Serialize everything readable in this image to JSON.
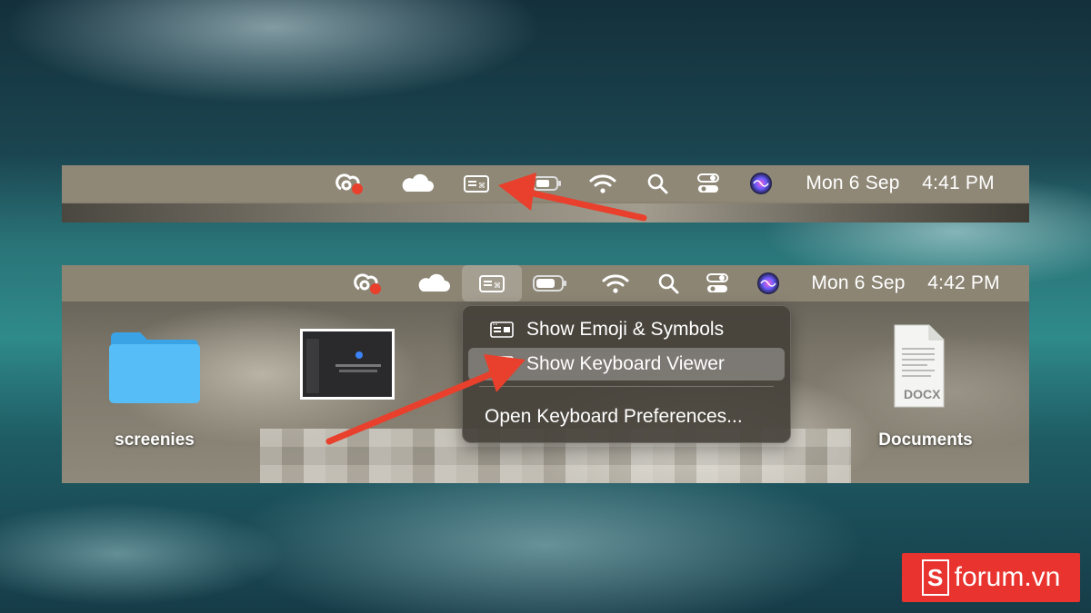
{
  "top_screenshot": {
    "menubar": {
      "date": "Mon 6 Sep",
      "time": "4:41 PM",
      "icons": [
        "creative-cloud-icon",
        "onedrive-icon",
        "input-menu-icon",
        "battery-icon",
        "wifi-icon",
        "spotlight-icon",
        "control-center-icon",
        "siri-icon"
      ]
    }
  },
  "bottom_screenshot": {
    "menubar": {
      "date": "Mon 6 Sep",
      "time": "4:42 PM",
      "icons": [
        "creative-cloud-icon",
        "onedrive-icon",
        "input-menu-icon",
        "battery-icon",
        "wifi-icon",
        "spotlight-icon",
        "control-center-icon",
        "siri-icon"
      ]
    },
    "menu": {
      "items": [
        {
          "label": "Show Emoji & Symbols",
          "icon": "emoji-symbols-icon"
        },
        {
          "label": "Show Keyboard Viewer",
          "icon": "keyboard-viewer-icon",
          "selected": true
        },
        {
          "label": "Open Keyboard Preferences..."
        }
      ]
    },
    "desktop": {
      "folder_label": "screenies",
      "document_label": "Documents",
      "document_badge": "DOCX"
    }
  },
  "watermark": {
    "logo_letter": "S",
    "text": "forum.vn"
  },
  "colors": {
    "arrow": "#e8402c",
    "watermark": "#e8332e",
    "folder": "#4fb6f5"
  }
}
